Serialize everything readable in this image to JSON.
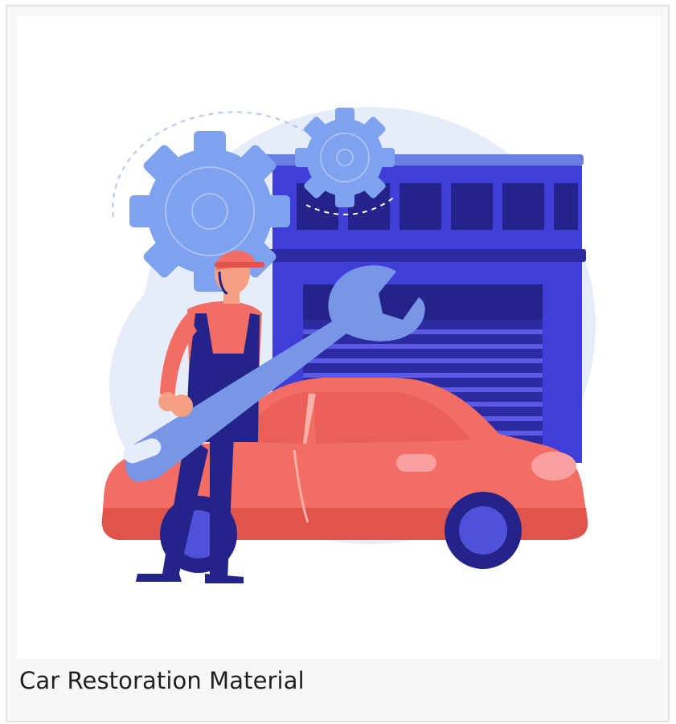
{
  "card": {
    "caption": "Car Restoration Material"
  },
  "illustration": {
    "subject": "car-repair-illustration",
    "colors": {
      "background_blob": "#e6ecf9",
      "garage_blue": "#3f3ed8",
      "garage_dark": "#2c2ba3",
      "gear_blue": "#7ea2ee",
      "car_red": "#f26d63",
      "car_red_dark": "#e0544c",
      "wrench": "#7797e6",
      "mechanic_skin": "#f5a082",
      "overalls": "#23238a",
      "wheel": "#23238a",
      "hubcap": "#4f52d8"
    }
  }
}
